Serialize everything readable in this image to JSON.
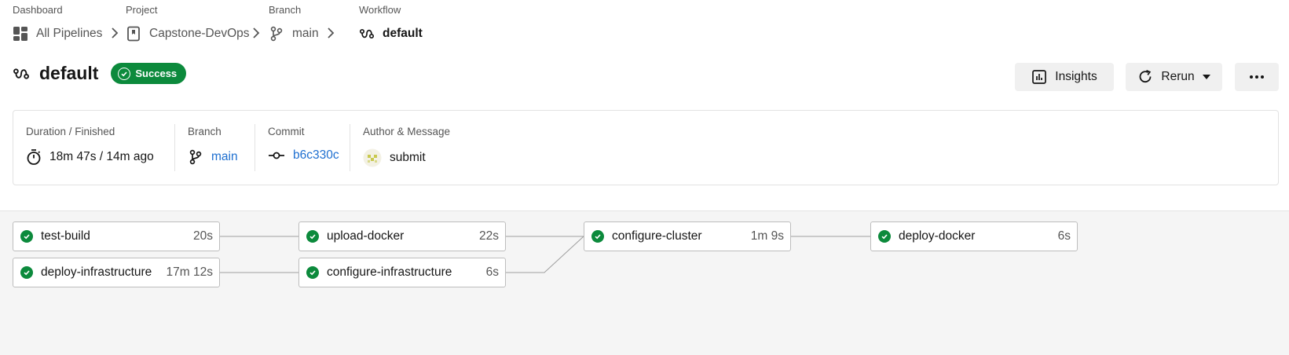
{
  "breadcrumbs": [
    {
      "label": "Dashboard",
      "value": "All Pipelines",
      "icon": "dashboard-icon"
    },
    {
      "label": "Project",
      "value": "Capstone-DevOps",
      "icon": "bookmark-icon"
    },
    {
      "label": "Branch",
      "value": "main",
      "icon": "branch-icon"
    },
    {
      "label": "Workflow",
      "value": "default",
      "icon": "workflow-icon"
    }
  ],
  "header": {
    "title": "default",
    "status": "Success",
    "status_color": "#0c8a3c",
    "insights_label": "Insights",
    "rerun_label": "Rerun"
  },
  "info": {
    "duration_label": "Duration / Finished",
    "duration_value": "18m 47s / 14m ago",
    "branch_label": "Branch",
    "branch_value": "main",
    "commit_label": "Commit",
    "commit_value": "b6c330c",
    "author_label": "Author & Message",
    "message": "submit"
  },
  "jobs": [
    {
      "name": "test-build",
      "duration": "20s"
    },
    {
      "name": "deploy-infrastructure",
      "duration": "17m 12s"
    },
    {
      "name": "upload-docker",
      "duration": "22s"
    },
    {
      "name": "configure-infrastructure",
      "duration": "6s"
    },
    {
      "name": "configure-cluster",
      "duration": "1m 9s"
    },
    {
      "name": "deploy-docker",
      "duration": "6s"
    }
  ],
  "colors": {
    "link": "#1e6fd0",
    "success": "#0c8a3c"
  }
}
